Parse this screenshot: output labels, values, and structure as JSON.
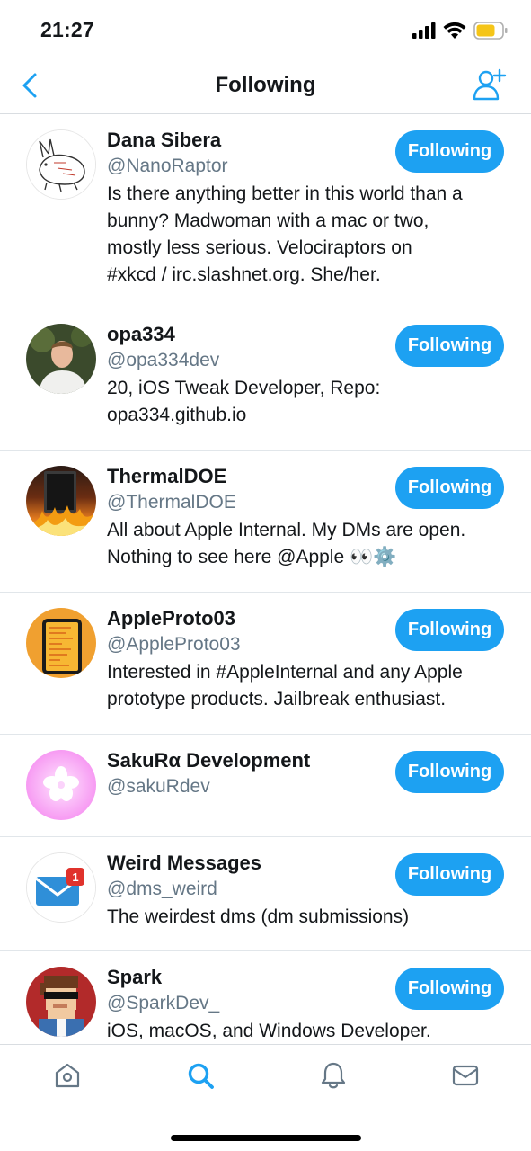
{
  "status_bar": {
    "time": "21:27"
  },
  "nav": {
    "title": "Following"
  },
  "colors": {
    "accent": "#1da1f2",
    "handle": "#657786",
    "text": "#14171a"
  },
  "accounts": [
    {
      "name": "Dana Sibera",
      "handle": "@NanoRaptor",
      "bio": "Is there anything better in this world than a\nbunny? Madwoman with a mac or two,\nmostly less serious. Velociraptors on\n#xkcd / irc.slashnet.org. She/her.",
      "button": "Following",
      "avatar": "bunny-sketch"
    },
    {
      "name": "opa334",
      "handle": "@opa334dev",
      "bio": "20, iOS Tweak Developer, Repo:\nopa334.github.io",
      "button": "Following",
      "avatar": "person-photo"
    },
    {
      "name": "ThermalDOE",
      "handle": "@ThermalDOE",
      "bio": "All about Apple Internal. My DMs are open.\nNothing to see here @Apple 👀⚙️",
      "button": "Following",
      "avatar": "device-on-fire"
    },
    {
      "name": "AppleProto03",
      "handle": "@AppleProto03",
      "bio": "Interested in #AppleInternal and any Apple\nprototype products. Jailbreak enthusiast.",
      "button": "Following",
      "avatar": "prototype-phone"
    },
    {
      "name": "SakuRα Development",
      "handle": "@sakuRdev",
      "bio": "",
      "button": "Following",
      "avatar": "sakura-flower"
    },
    {
      "name": "Weird Messages",
      "handle": "@dms_weird",
      "bio": "The weirdest dms (dm submissions)",
      "button": "Following",
      "avatar": "envelope-badge",
      "badge": "1"
    },
    {
      "name": "Spark",
      "handle": "@SparkDev_",
      "bio": "iOS, macOS, and Windows Developer.",
      "button": "Following",
      "avatar": "pixel-character"
    }
  ],
  "tabs": [
    {
      "icon": "home-icon",
      "active": false
    },
    {
      "icon": "search-icon",
      "active": true
    },
    {
      "icon": "bell-icon",
      "active": false
    },
    {
      "icon": "mail-icon",
      "active": false
    }
  ]
}
